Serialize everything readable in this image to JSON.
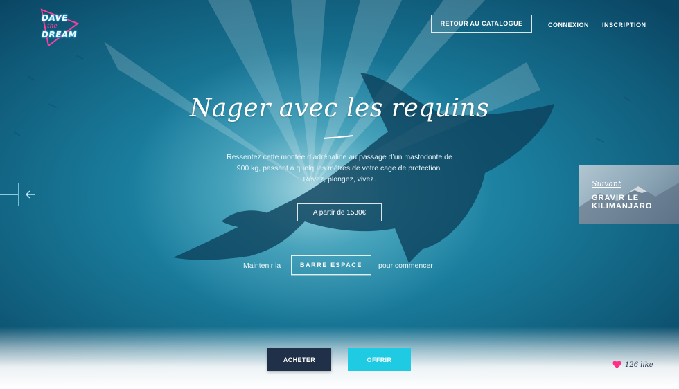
{
  "brand": {
    "logo_line1": "DAVE",
    "logo_line2": "the",
    "logo_line3": "DREAM"
  },
  "nav": {
    "catalog_button": "RETOUR AU CATALOGUE",
    "login": "CONNEXION",
    "signup": "INSCRIPTION"
  },
  "hero": {
    "title": "Nager avec les requins",
    "description_line1": "Ressentez cette montée d’adrénaline au passage d’un mastodonte de",
    "description_line2": "900 kg, passant à quelques mètres de votre cage de protection.",
    "description_line3": "Rêvez, plongez, vivez.",
    "price_label": "A partir de 1530€"
  },
  "hint": {
    "before": "Maintenir la",
    "key": "BARRE ESPACE",
    "after": "pour commencer"
  },
  "next": {
    "label": "Suivant",
    "title_line1": "GRAVIR LE",
    "title_line2": "KILIMANJARO"
  },
  "actions": {
    "buy": "ACHETER",
    "gift": "OFFRIR"
  },
  "likes": {
    "count_label": "126 like"
  },
  "colors": {
    "buy_bg": "#203049",
    "gift_bg": "#1ecbe3",
    "heart": "#ff2e86"
  },
  "icons": {
    "prev": "arrow-left-icon",
    "like": "heart-icon"
  }
}
